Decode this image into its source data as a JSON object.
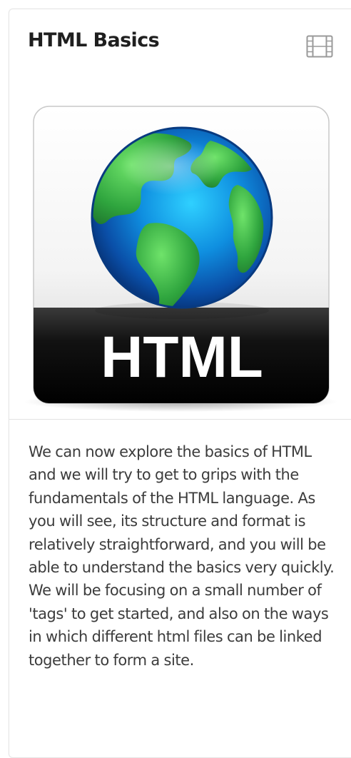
{
  "card": {
    "title": "HTML Basics",
    "type_icon": "film-icon",
    "thumbnail": {
      "icon": "html-file-globe-icon",
      "logo_text": "HTML"
    },
    "description": "We can now explore the basics of HTML and we will try to get to grips with the fundamentals of the HTML language. As you will see, its structure and format is relatively straightforward, and you will be able to understand the basics very quickly. We will be focusing on a small number of 'tags' to get started, and also on the ways in which different html files can be linked together to form a site."
  },
  "colors": {
    "title": "#1f1f1f",
    "body_text": "#3c3c3c",
    "border": "#e6e6e6",
    "globe_ocean": "#1aa3e8",
    "globe_land": "#3fb24a",
    "logo_band": "#111111"
  }
}
